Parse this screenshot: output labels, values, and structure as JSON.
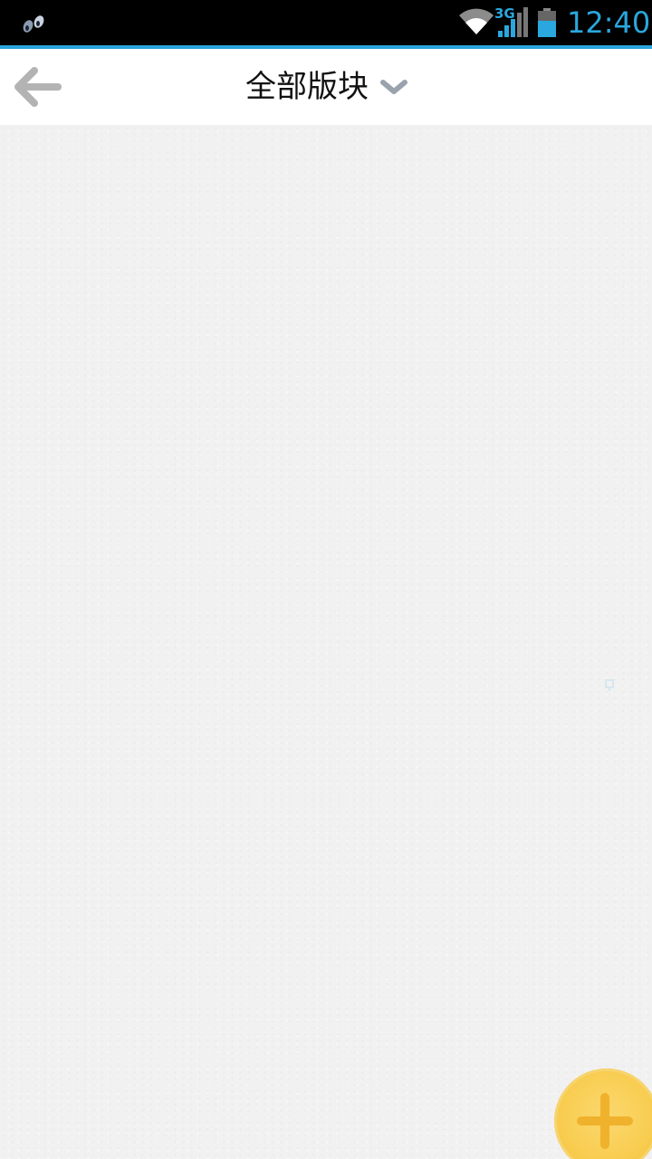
{
  "status_bar": {
    "time": "12:40",
    "network": "3G",
    "icons": [
      "notification-icon",
      "wifi-icon",
      "signal-icon",
      "battery-icon"
    ],
    "accent_color": "#2aa7de"
  },
  "action_bar": {
    "title": "全部版块",
    "back_icon": "back-arrow-icon",
    "dropdown_icon": "chevron-down-icon"
  },
  "fab": {
    "icon": "plus-icon",
    "color": "#f8cc4f"
  }
}
